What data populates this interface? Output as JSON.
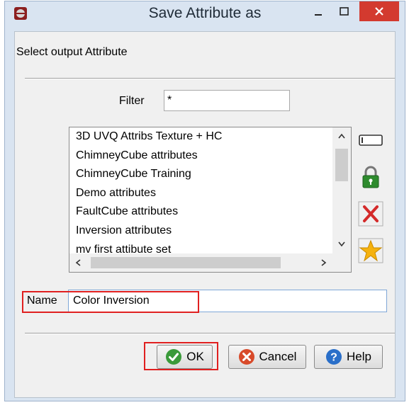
{
  "window": {
    "title": "Save Attribute as"
  },
  "dialog": {
    "heading": "Select output Attribute",
    "filter": {
      "label": "Filter",
      "value": "*"
    },
    "list": {
      "items": [
        "3D UVQ Attribs Texture + HC",
        "ChimneyCube attributes",
        "ChimneyCube Training",
        "Demo attributes",
        "FaultCube attributes",
        "Inversion attributes",
        "mv first attibute set"
      ]
    },
    "side_buttons": [
      "rename-icon",
      "lock-icon",
      "delete-icon",
      "star-icon"
    ],
    "name": {
      "label": "Name",
      "value": "Color Inversion"
    },
    "buttons": {
      "ok": "OK",
      "cancel": "Cancel",
      "help": "Help"
    }
  },
  "colors": {
    "close": "#d33a2f",
    "highlight": "#e02020",
    "ok": "#3a9a3a",
    "cancel": "#d84a2a",
    "help": "#2a6fc9"
  }
}
